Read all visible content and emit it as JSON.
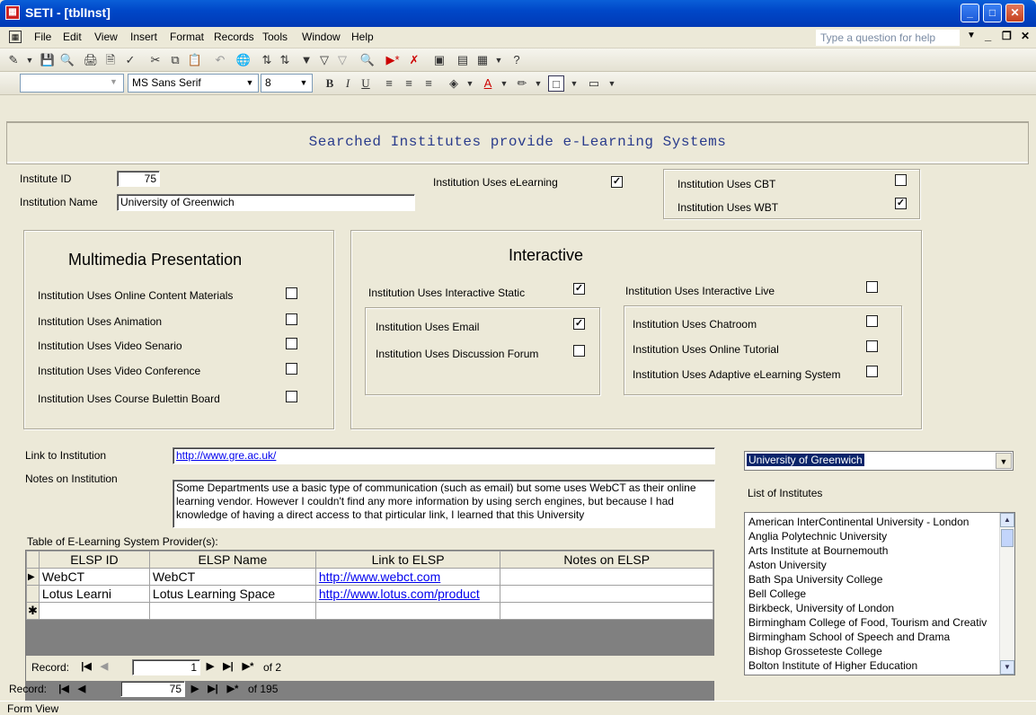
{
  "window": {
    "title": "SETI - [tblInst]",
    "app_icon": "access-form-icon"
  },
  "menu": [
    "File",
    "Edit",
    "View",
    "Insert",
    "Format",
    "Records",
    "Tools",
    "Window",
    "Help"
  ],
  "help_placeholder": "Type a question for help",
  "format_bar": {
    "object": "",
    "font": "MS Sans Serif",
    "size": "8"
  },
  "form": {
    "title": "Searched Institutes provide e-Learning Systems",
    "institute_id_label": "Institute ID",
    "institute_id": "75",
    "name_label": "Institution Name",
    "name": "University of Greenwich",
    "uses_elearning_label": "Institution Uses eLearning",
    "uses_elearning": true,
    "uses_cbt_label": "Institution Uses CBT",
    "uses_cbt": false,
    "uses_wbt_label": "Institution Uses WBT",
    "uses_wbt": true,
    "multimedia": {
      "heading": "Multimedia Presentation",
      "items": [
        {
          "label": "Institution Uses Online Content Materials",
          "checked": false
        },
        {
          "label": "Institution Uses Animation",
          "checked": false
        },
        {
          "label": "Institution Uses Video Senario",
          "checked": false
        },
        {
          "label": "Institution Uses Video Conference",
          "checked": false
        },
        {
          "label": "Institution Uses Course Bulettin Board",
          "checked": false
        }
      ]
    },
    "interactive": {
      "heading": "Interactive",
      "static_label": "Institution Uses Interactive Static",
      "static": true,
      "live_label": "Institution Uses Interactive Live",
      "live": false,
      "static_items": [
        {
          "label": "Institution Uses Email",
          "checked": true
        },
        {
          "label": "Institution Uses Discussion Forum",
          "checked": false
        }
      ],
      "live_items": [
        {
          "label": "Institution Uses Chatroom",
          "checked": false
        },
        {
          "label": "Institution Uses Online Tutorial",
          "checked": false
        },
        {
          "label": "Institution Uses Adaptive eLearning System",
          "checked": false
        }
      ]
    },
    "link_label": "Link to Institution",
    "link": "http://www.gre.ac.uk/",
    "notes_label": "Notes on Institution",
    "notes": "Some Departments use a basic type of communication (such as email) but some uses WebCT as their online learning vendor. However I couldn't find any more information by using serch engines, but because I had knowledge of having a direct access to that pirticular link,  I learned that this University",
    "table_label": "Table of E-Learning System Provider(s):",
    "table": {
      "headers": [
        "ELSP ID",
        "ELSP Name",
        "Link to ELSP",
        "Notes on ELSP"
      ],
      "rows": [
        [
          "WebCT",
          "WebCT",
          "http://www.webct.com",
          ""
        ],
        [
          "Lotus Learni",
          "Lotus Learning Space",
          "http://www.lotus.com/product",
          ""
        ]
      ]
    },
    "sub_nav": {
      "label": "Record:",
      "current": "1",
      "total": "of 2"
    },
    "main_nav": {
      "label": "Record:",
      "current": "75",
      "total": "of 195"
    },
    "lookup_combo": "University of Greenwich",
    "list_label": "List of Institutes",
    "institutes": [
      "American InterContinental University - London",
      "Anglia Polytechnic University",
      "Arts Institute at Bournemouth",
      "Aston University",
      "Bath Spa University College",
      "Bell College",
      "Birkbeck, University of London",
      "Birmingham College of Food, Tourism and Creativ",
      "Birmingham School of Speech and Drama",
      "Bishop Grosseteste College",
      "Bolton Institute of Higher Education"
    ]
  },
  "status": "Form View"
}
